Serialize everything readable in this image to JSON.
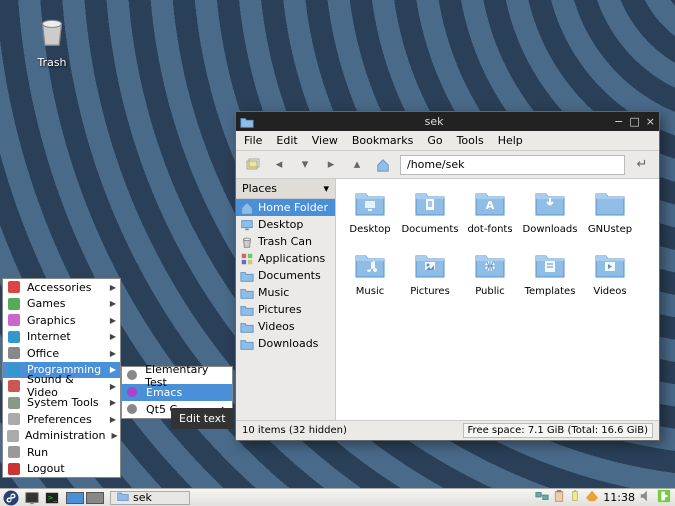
{
  "desktop": {
    "trash_label": "Trash"
  },
  "appmenu": {
    "items": [
      {
        "label": "Accessories",
        "submenu": true
      },
      {
        "label": "Games",
        "submenu": true
      },
      {
        "label": "Graphics",
        "submenu": true
      },
      {
        "label": "Internet",
        "submenu": true
      },
      {
        "label": "Office",
        "submenu": true
      },
      {
        "label": "Programming",
        "submenu": true,
        "selected": true
      },
      {
        "label": "Sound & Video",
        "submenu": true
      },
      {
        "label": "System Tools",
        "submenu": true
      },
      {
        "label": "Preferences",
        "submenu": true
      },
      {
        "label": "Administration",
        "submenu": true
      },
      {
        "label": "Run",
        "submenu": false
      },
      {
        "label": "Logout",
        "submenu": false
      }
    ]
  },
  "submenu": {
    "items": [
      {
        "label": "Elementary Test"
      },
      {
        "label": "Emacs",
        "selected": true
      },
      {
        "label": "Qt5 C…",
        "submenu": true
      }
    ]
  },
  "tooltip": "Edit text",
  "fm": {
    "title": "sek",
    "menubar": [
      "File",
      "Edit",
      "View",
      "Bookmarks",
      "Go",
      "Tools",
      "Help"
    ],
    "path": "/home/sek",
    "sidebar": {
      "header": "Places",
      "items": [
        {
          "label": "Home Folder",
          "icon": "home",
          "selected": true
        },
        {
          "label": "Desktop",
          "icon": "desktop"
        },
        {
          "label": "Trash Can",
          "icon": "trash"
        },
        {
          "label": "Applications",
          "icon": "apps"
        },
        {
          "label": "Documents",
          "icon": "folder"
        },
        {
          "label": "Music",
          "icon": "folder"
        },
        {
          "label": "Pictures",
          "icon": "folder"
        },
        {
          "label": "Videos",
          "icon": "folder"
        },
        {
          "label": "Downloads",
          "icon": "folder"
        }
      ]
    },
    "files": [
      {
        "label": "Desktop",
        "glyph": "desktop"
      },
      {
        "label": "Documents",
        "glyph": "doc"
      },
      {
        "label": "dot-fonts",
        "glyph": "font"
      },
      {
        "label": "Downloads",
        "glyph": "download"
      },
      {
        "label": "GNUstep",
        "glyph": "plain"
      },
      {
        "label": "Music",
        "glyph": "music"
      },
      {
        "label": "Pictures",
        "glyph": "picture"
      },
      {
        "label": "Public",
        "glyph": "public"
      },
      {
        "label": "Templates",
        "glyph": "template"
      },
      {
        "label": "Videos",
        "glyph": "video"
      }
    ],
    "status_left": "10 items (32 hidden)",
    "status_right": "Free space: 7.1 GiB (Total: 16.6 GiB)"
  },
  "taskbar": {
    "task_label": "sek",
    "clock": "11:38"
  },
  "colors": {
    "highlight": "#4a90d9",
    "folder_fill": "#8fbde6",
    "folder_stroke": "#5a93c8"
  }
}
